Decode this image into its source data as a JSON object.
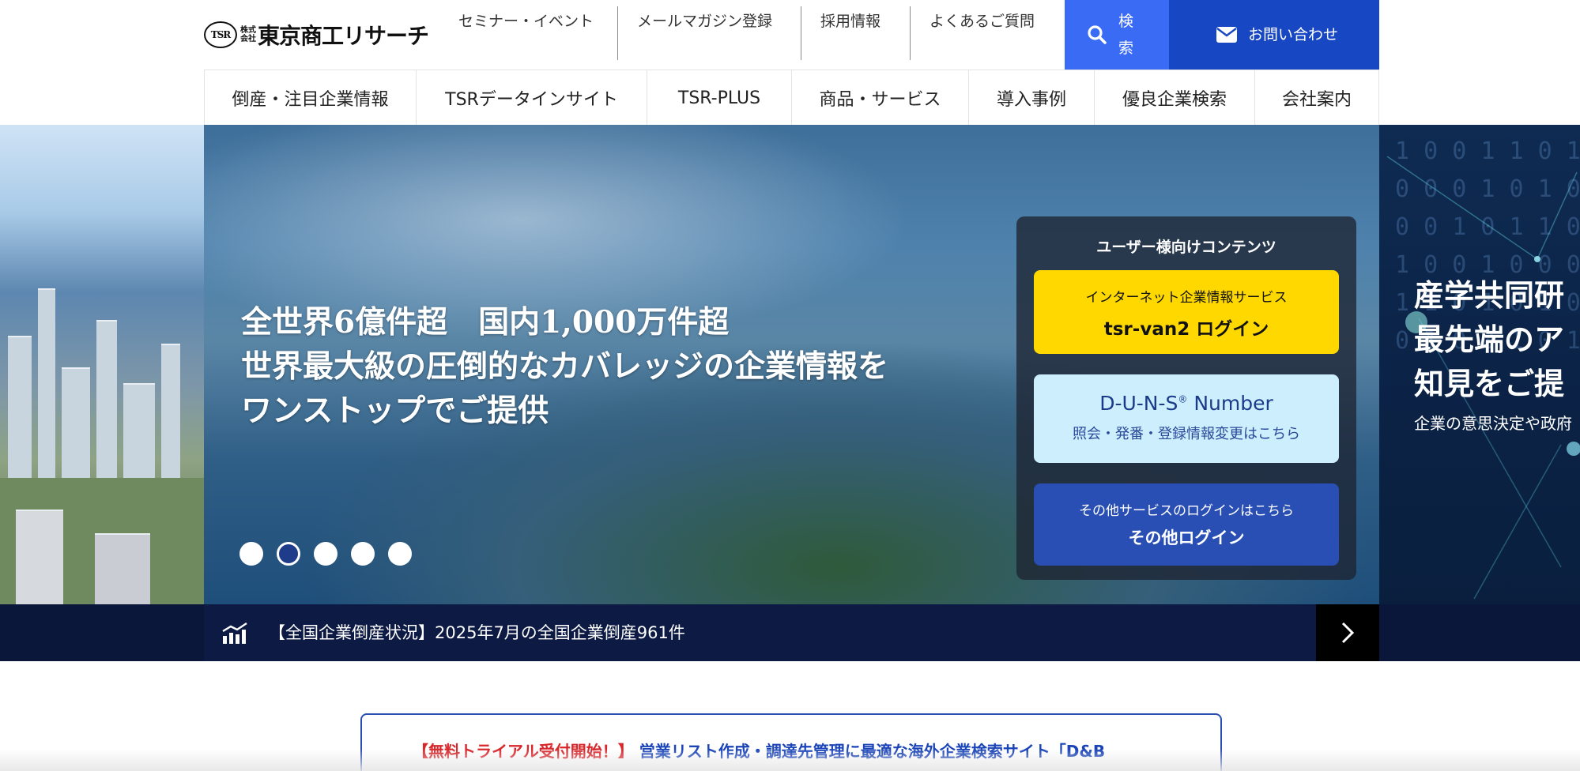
{
  "header": {
    "logo": {
      "mark": "TSR",
      "kk_top": "株式",
      "kk_bottom": "会社",
      "name": "東京商工リサーチ"
    },
    "util_nav": [
      {
        "label": "セミナー・イベント"
      },
      {
        "label": "メールマガジン登録"
      },
      {
        "label": "採用情報"
      },
      {
        "label": "よくあるご質問"
      }
    ],
    "search_label": "検索",
    "contact_label": "お問い合わせ",
    "main_nav": [
      {
        "label": "倒産・注目企業情報"
      },
      {
        "label": "TSRデータインサイト"
      },
      {
        "label": "TSR-PLUS"
      },
      {
        "label": "商品・サービス"
      },
      {
        "label": "導入事例"
      },
      {
        "label": "優良企業検索"
      },
      {
        "label": "会社案内"
      }
    ]
  },
  "hero": {
    "copy_line1": "全世界6億件超　国内1,000万件超",
    "copy_line2": "世界最大級の圧倒的なカバレッジの企業情報を",
    "copy_line3": "ワンストップでご提供",
    "active_slide": 2,
    "slide_count": 5,
    "next_slide": {
      "title_line1": "産学共同研",
      "title_line2": "最先端のア",
      "title_line3": "知見をご提",
      "subtitle": "企業の意思決定や政府"
    }
  },
  "login_panel": {
    "title": "ユーザー様向けコンテンツ",
    "tsr_van2": {
      "sub": "インターネット企業情報サービス",
      "main": "tsr-van2 ログイン"
    },
    "duns": {
      "main_prefix": "D-U-N-S",
      "main_mark": "®",
      "main_suffix": " Number",
      "sub": "照会・発番・登録情報変更はこちら"
    },
    "other": {
      "sub": "その他サービスのログインはこちら",
      "main": "その他ログイン"
    }
  },
  "news": {
    "text": "【全国企業倒産状況】2025年7月の全国企業倒産961件"
  },
  "banner": {
    "red": "【無料トライアル受付開始！】",
    "blue": "営業リスト作成・調達先管理に最適な海外企業検索サイト「D&B"
  },
  "colors": {
    "search_bg": "#3a6bf5",
    "contact_bg": "#1747c3",
    "tsr_van2_bg": "#ffd800",
    "duns_bg": "#cdeefd",
    "other_login_bg": "#2a4fb4",
    "news_bg": "#0c1a44",
    "banner_red": "#d8262a",
    "banner_blue": "#1a44b8"
  },
  "icons": {
    "search": "search-icon",
    "contact": "mail-icon",
    "news": "chart-icon",
    "next": "chevron-right-icon"
  }
}
